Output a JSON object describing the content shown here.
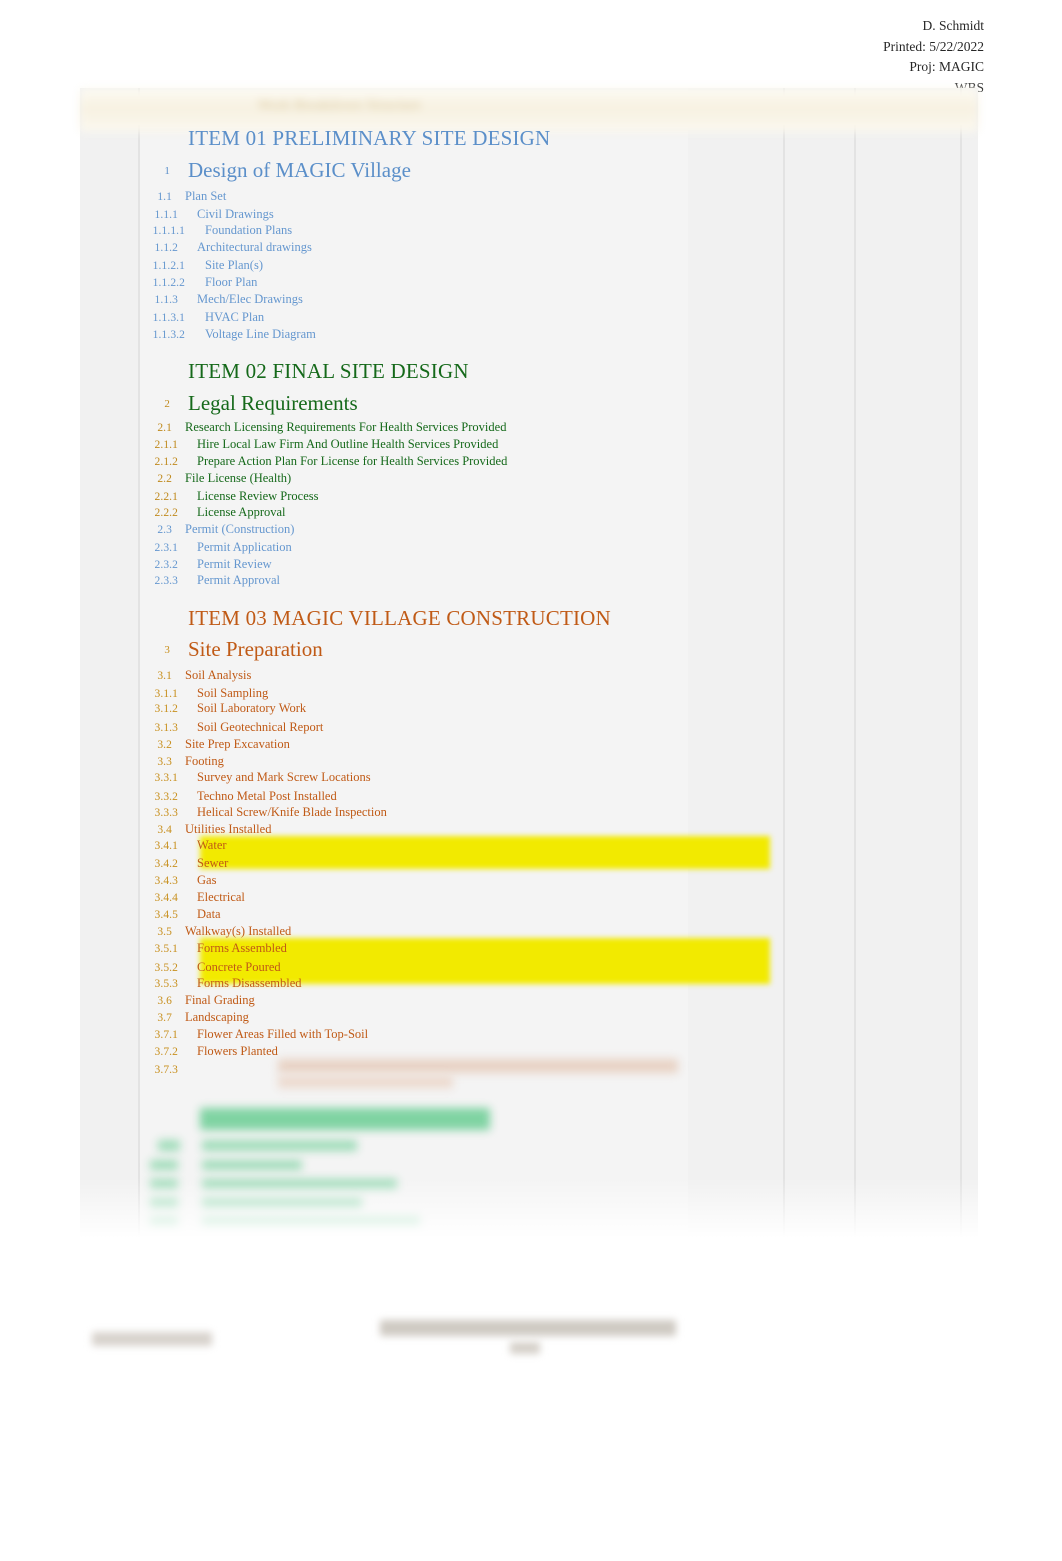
{
  "header": {
    "author": "D. Schmidt",
    "printed": "Printed: 5/22/2022",
    "project": "Proj: MAGIC",
    "doc_type": "WBS"
  },
  "table_header": {
    "title_blurred": "Work Breakdown Structure",
    "columns": [
      "",
      "",
      "",
      "",
      "",
      "",
      ""
    ]
  },
  "colors": {
    "item01_blue": "#5b8fc9",
    "item02_green": "#15691a",
    "item02_number_gold": "#c08a1e",
    "item03_orange": "#c05a16",
    "item03_number_gold": "#c8901f",
    "highlight_yellow": "#f2ea00",
    "item04_green_blurred": "#9fdcb9",
    "sheet_background": "#f1f1f1"
  },
  "sections": [
    {
      "id": "item-01",
      "heading": "ITEM 01 PRELIMINARY SITE DESIGN",
      "theme": "blue",
      "rows": [
        {
          "wbs": "1",
          "task": "Design of MAGIC Village",
          "level": 1
        },
        {
          "wbs": "1.1",
          "task": "Plan Set",
          "level": 2
        },
        {
          "wbs": "1.1.1",
          "task": "Civil Drawings",
          "level": 3
        },
        {
          "wbs": "1.1.1.1",
          "task": "Foundation Plans",
          "level": 4
        },
        {
          "wbs": "1.1.2",
          "task": "Architectural drawings",
          "level": 3
        },
        {
          "wbs": "1.1.2.1",
          "task": "Site Plan(s)",
          "level": 4
        },
        {
          "wbs": "1.1.2.2",
          "task": "Floor Plan",
          "level": 4
        },
        {
          "wbs": "1.1.3",
          "task": "Mech/Elec Drawings",
          "level": 3
        },
        {
          "wbs": "1.1.3.1",
          "task": "HVAC Plan",
          "level": 4
        },
        {
          "wbs": "1.1.3.2",
          "task": "Voltage Line Diagram",
          "level": 4
        }
      ]
    },
    {
      "id": "item-02",
      "heading": "ITEM 02 FINAL SITE DESIGN",
      "theme": "green",
      "rows": [
        {
          "wbs": "2",
          "task": "Legal Requirements",
          "level": 1
        },
        {
          "wbs": "2.1",
          "task": "Research Licensing Requirements For Health Services Provided",
          "level": 2
        },
        {
          "wbs": "2.1.1",
          "task": "Hire Local Law Firm And Outline Health Services Provided",
          "level": 3
        },
        {
          "wbs": "2.1.2",
          "task": "Prepare Action Plan For License for Health Services Provided",
          "level": 3
        },
        {
          "wbs": "2.2",
          "task": "File License (Health)",
          "level": 2
        },
        {
          "wbs": "2.2.1",
          "task": "License Review Process",
          "level": 3
        },
        {
          "wbs": "2.2.2",
          "task": "License Approval",
          "level": 3
        },
        {
          "wbs": "2.3",
          "task": "Permit (Construction)",
          "level": 2,
          "theme": "blue"
        },
        {
          "wbs": "2.3.1",
          "task": "Permit Application",
          "level": 3,
          "theme": "blue"
        },
        {
          "wbs": "2.3.2",
          "task": "Permit Review",
          "level": 3,
          "theme": "blue"
        },
        {
          "wbs": "2.3.3",
          "task": "Permit Approval",
          "level": 3,
          "theme": "blue"
        }
      ]
    },
    {
      "id": "item-03",
      "heading": "ITEM 03 MAGIC VILLAGE CONSTRUCTION",
      "theme": "orange",
      "rows": [
        {
          "wbs": "3",
          "task": "Site Preparation",
          "level": 1
        },
        {
          "wbs": "3.1",
          "task": "Soil Analysis",
          "level": 2
        },
        {
          "wbs": "3.1.1",
          "task": "Soil Sampling",
          "level": 3
        },
        {
          "wbs": "3.1.2",
          "task": "Soil Laboratory Work",
          "level": 3
        },
        {
          "wbs": "3.1.3",
          "task": "Soil Geotechnical Report",
          "level": 3
        },
        {
          "wbs": "3.2",
          "task": "Site Prep Excavation",
          "level": 2
        },
        {
          "wbs": "3.3",
          "task": "Footing",
          "level": 2
        },
        {
          "wbs": "3.3.1",
          "task": "Survey and Mark Screw Locations",
          "level": 3
        },
        {
          "wbs": "3.3.2",
          "task": "Techno Metal Post Installed",
          "level": 3
        },
        {
          "wbs": "3.3.3",
          "task": "Helical Screw/Knife Blade Inspection",
          "level": 3
        },
        {
          "wbs": "3.4",
          "task": "Utilities Installed",
          "level": 2
        },
        {
          "wbs": "3.4.1",
          "task": "Water",
          "level": 3,
          "highlight": "yellow"
        },
        {
          "wbs": "3.4.2",
          "task": "Sewer",
          "level": 3,
          "highlight": "yellow"
        },
        {
          "wbs": "3.4.3",
          "task": "Gas",
          "level": 3
        },
        {
          "wbs": "3.4.4",
          "task": "Electrical",
          "level": 3
        },
        {
          "wbs": "3.4.5",
          "task": "Data",
          "level": 3
        },
        {
          "wbs": "3.5",
          "task": "Walkway(s) Installed",
          "level": 2
        },
        {
          "wbs": "3.5.1",
          "task": "Forms Assembled",
          "level": 3,
          "highlight": "yellow"
        },
        {
          "wbs": "3.5.2",
          "task": "Concrete Poured",
          "level": 3,
          "highlight": "yellow"
        },
        {
          "wbs": "3.5.3",
          "task": "Forms Disassembled",
          "level": 3,
          "highlight": "yellow"
        },
        {
          "wbs": "3.6",
          "task": "Final Grading",
          "level": 2
        },
        {
          "wbs": "3.7",
          "task": "Landscaping",
          "level": 2
        },
        {
          "wbs": "3.7.1",
          "task": "Flower Areas Filled with Top-Soil",
          "level": 3
        },
        {
          "wbs": "3.7.2",
          "task": "Flowers Planted",
          "level": 3
        },
        {
          "wbs": "3.7.3",
          "task": "",
          "level": 3,
          "illegible": true
        }
      ]
    },
    {
      "id": "item-04",
      "heading": "",
      "theme": "green-light",
      "illegible": true,
      "rows": []
    }
  ],
  "footer": {
    "left_blurred": "",
    "center_blurred": ""
  }
}
